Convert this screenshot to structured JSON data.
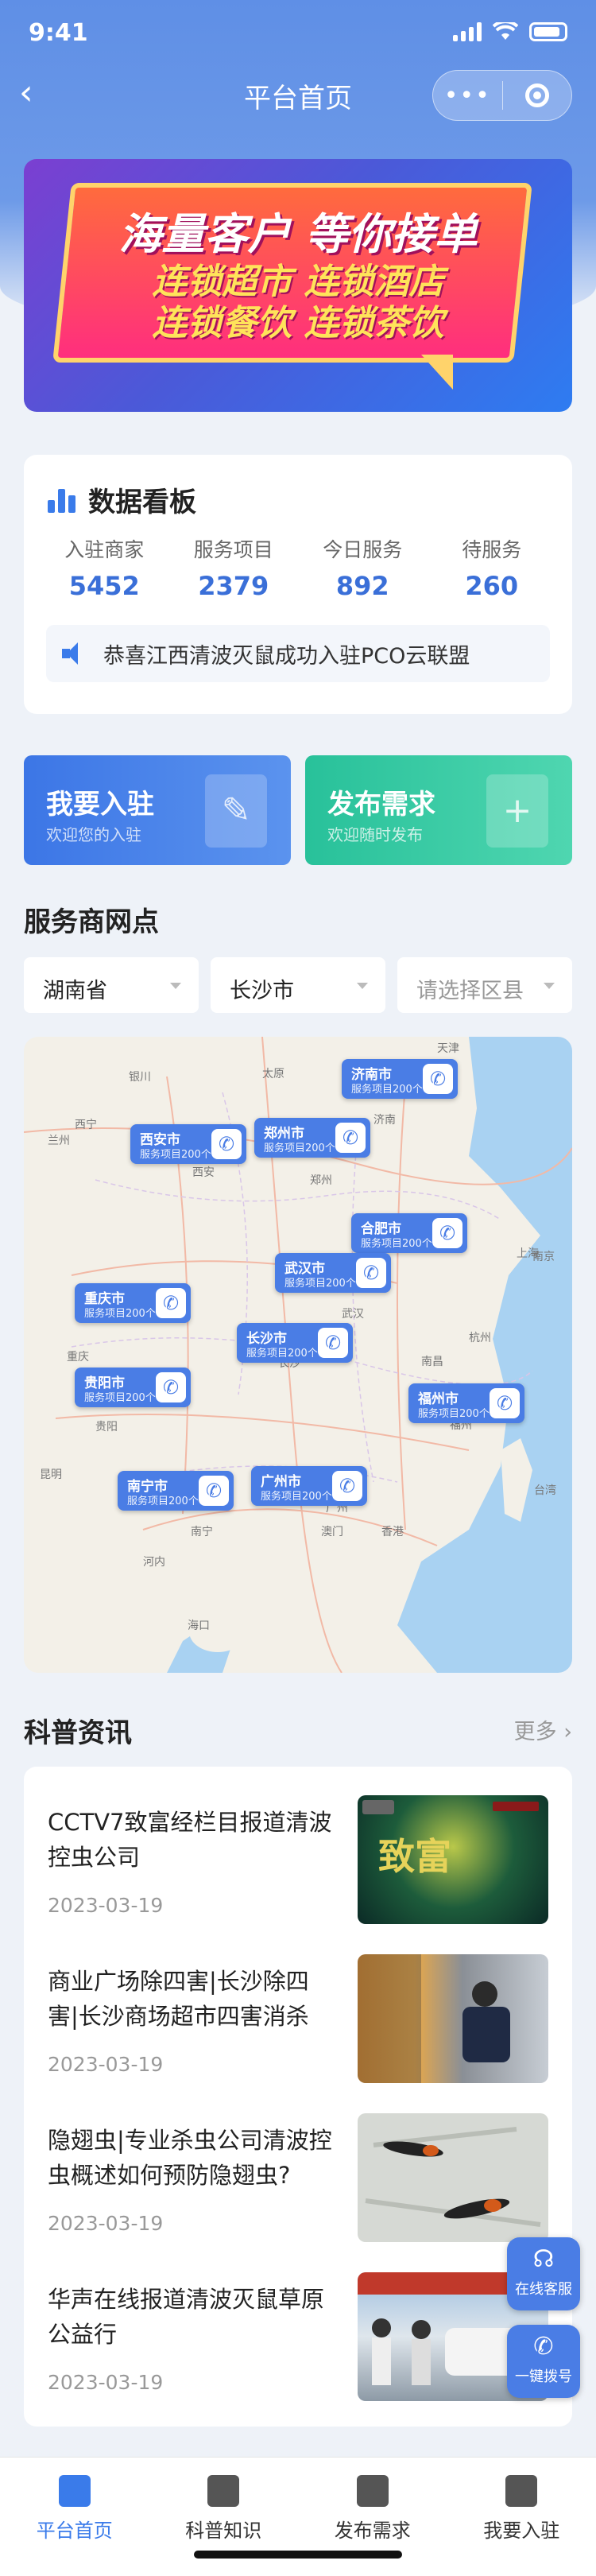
{
  "status": {
    "time": "9:41"
  },
  "nav": {
    "title": "平台首页",
    "back": "‹",
    "more": "•••"
  },
  "banner": {
    "line1": "海量客户 等你接单",
    "line2": "连锁超市 连锁酒店",
    "line3": "连锁餐饮 连锁茶饮"
  },
  "dashboard": {
    "title": "数据看板",
    "stats": [
      {
        "label": "入驻商家",
        "value": "5452"
      },
      {
        "label": "服务项目",
        "value": "2379"
      },
      {
        "label": "今日服务",
        "value": "892"
      },
      {
        "label": "待服务",
        "value": "260"
      }
    ],
    "notice": "恭喜江西清波灭鼠成功入驻PCO云联盟"
  },
  "actions": {
    "join": {
      "title": "我要入驻",
      "subtitle": "欢迎您的入驻",
      "icon": "✎"
    },
    "publish": {
      "title": "发布需求",
      "subtitle": "欢迎随时发布",
      "icon": "+"
    }
  },
  "service_points": {
    "title": "服务商网点",
    "province": "湖南省",
    "city": "长沙市",
    "district_placeholder": "请选择区县",
    "map_labels": [
      "天津",
      "太原",
      "银川",
      "兰州",
      "西宁",
      "济南",
      "郑州",
      "西安",
      "合肥",
      "武汉",
      "南京",
      "上海",
      "杭州",
      "重庆",
      "长沙",
      "南昌",
      "贵阳",
      "福州",
      "昆明",
      "南宁",
      "广州",
      "香港",
      "澳门",
      "海口",
      "台湾",
      "河内"
    ],
    "pins": [
      {
        "city": "济南市",
        "sub": "服务项目200个"
      },
      {
        "city": "西安市",
        "sub": "服务项目200个"
      },
      {
        "city": "郑州市",
        "sub": "服务项目200个"
      },
      {
        "city": "合肥市",
        "sub": "服务项目200个"
      },
      {
        "city": "武汉市",
        "sub": "服务项目200个"
      },
      {
        "city": "重庆市",
        "sub": "服务项目200个"
      },
      {
        "city": "长沙市",
        "sub": "服务项目200个"
      },
      {
        "city": "贵阳市",
        "sub": "服务项目200个"
      },
      {
        "city": "福州市",
        "sub": "服务项目200个"
      },
      {
        "city": "南宁市",
        "sub": "服务项目200个"
      },
      {
        "city": "广州市",
        "sub": "服务项目200个"
      }
    ]
  },
  "news": {
    "title": "科普资讯",
    "more": "更多 ›",
    "items": [
      {
        "title": "CCTV7致富经栏目报道清波控虫公司",
        "date": "2023-03-19"
      },
      {
        "title": "商业广场除四害|长沙除四害|长沙商场超市四害消杀",
        "date": "2023-03-19"
      },
      {
        "title": "隐翅虫|专业杀虫公司清波控虫概述如何预防隐翅虫?",
        "date": "2023-03-19"
      },
      {
        "title": "华声在线报道清波灭鼠草原公益行",
        "date": "2023-03-19"
      }
    ]
  },
  "floats": {
    "service": "在线客服",
    "call": "一键拨号"
  },
  "tabs": [
    {
      "label": "平台首页"
    },
    {
      "label": "科普知识"
    },
    {
      "label": "发布需求"
    },
    {
      "label": "我要入驻"
    }
  ]
}
